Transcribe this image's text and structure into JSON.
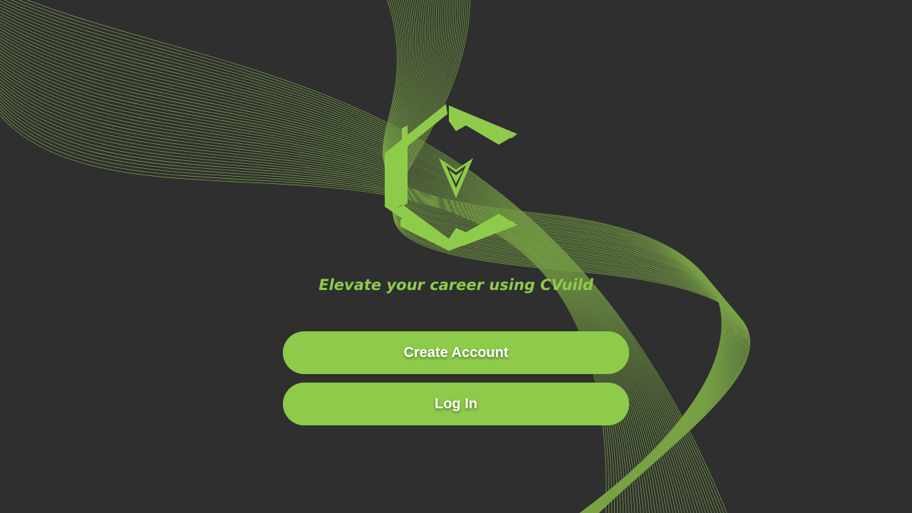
{
  "colors": {
    "background": "#2f2f2f",
    "accent": "#8ecb4b",
    "wave_line": "#86b84a",
    "button_text": "#ffffff"
  },
  "logo": {
    "icon": "cvuild-hexagon-c-logo"
  },
  "tagline": {
    "prefix": "Elevate your career using ",
    "brand": "CVuild"
  },
  "actions": {
    "create_account_label": "Create Account",
    "login_label": "Log In"
  }
}
